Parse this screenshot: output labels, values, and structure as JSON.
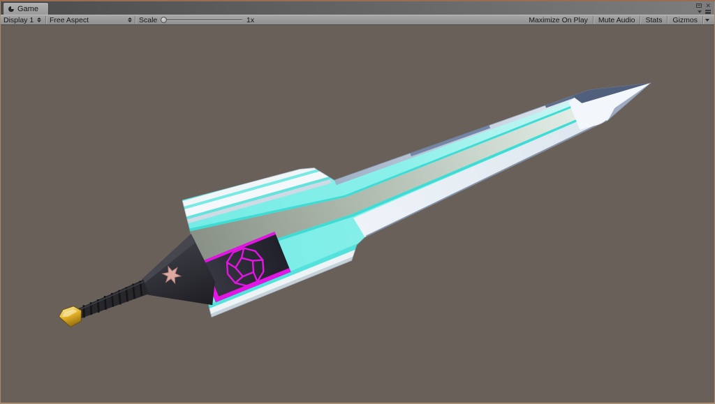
{
  "tab": {
    "label": "Game",
    "icon": "game-view-icon"
  },
  "window_controls": {
    "row1_icons": [
      "pin-icon",
      "close-icon"
    ],
    "row2_icons": [
      "dropdown-icon",
      "tab-menu-icon"
    ]
  },
  "toolbar": {
    "display_dropdown": {
      "label": "Display 1",
      "icon": "popup-arrows-icon"
    },
    "aspect_dropdown": {
      "label": "Free Aspect",
      "icon": "popup-arrows-icon"
    },
    "scale": {
      "label": "Scale",
      "value": "1x",
      "slider_position": "minimum"
    },
    "buttons": [
      {
        "label": "Maximize On Play"
      },
      {
        "label": "Mute Audio"
      },
      {
        "label": "Stats"
      },
      {
        "label": "Gizmos",
        "has_dropdown": true
      }
    ]
  },
  "viewport": {
    "description": "Unity Game view rendering a low-poly stylized greatsword pointing to the upper right: cyan-and-silver blade with a gray-green fuller, dark plate with magenta dodecahedron wireframe emblem, dark guard with a pink six-pointed star, segmented dark grip and gold hexagonal pommel",
    "colors": {
      "background": "#696059",
      "blade_cyan": "#7deee8",
      "blade_pale": "#e6f8f8",
      "fuller_dark": "#8d978d",
      "fuller_light": "#e6f2ea",
      "accent_cyan_line": "#3fdcd6",
      "edge_silver": "#c3d0de",
      "facet_dark_blue": "#505f7c",
      "plate_dark": "#26262e",
      "emblem_magenta": "#e414e4",
      "grip_dark": "#26262b",
      "pommel_gold": "#e8b92e",
      "star_pink": "#dcaaa2"
    }
  }
}
